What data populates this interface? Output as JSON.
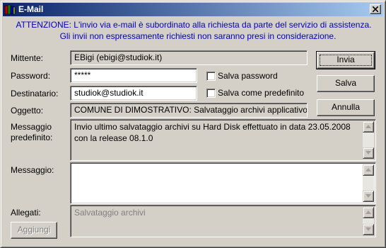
{
  "window": {
    "title": "E-Mail",
    "close_symbol": "×"
  },
  "notice": {
    "line1": "ATTENZIONE: L'invio via e-mail è subordinato alla richiesta da parte del servizio di assistenza.",
    "line2": "Gli invii non espressamente richiesti non saranno presi in considerazione.",
    "color": "#0000c0"
  },
  "form": {
    "mittente_label": "Mittente:",
    "mittente_value": "EBigi (ebigi@studiok.it)",
    "password_label": "Password:",
    "password_value": "*****",
    "salva_password_label": "Salva password",
    "salva_password_checked": false,
    "destinatario_label": "Destinatario:",
    "destinatario_value": "studiok@studiok.it",
    "salva_predefinito_label": "Salva come predefinito",
    "salva_predefinito_checked": false,
    "oggetto_label": "Oggetto:",
    "oggetto_value": "COMUNE DI DIMOSTRATIVO: Salvataggio archivi applicativo",
    "messaggio_predefinito_label_1": "Messaggio",
    "messaggio_predefinito_label_2": "predefinito:",
    "messaggio_predefinito_value_1": "Invio ultimo salvataggio archivi su Hard Disk effettuato in data 23.05.2008",
    "messaggio_predefinito_value_2": "con la release 08.1.0",
    "messaggio_label": "Messaggio:",
    "messaggio_value": "",
    "allegati_label": "Allegati:",
    "allegati_value": "Salvataggio archivi"
  },
  "buttons": {
    "invia": "Invia",
    "salva": "Salva",
    "annulla": "Annulla",
    "aggiungi": "Aggiungi"
  },
  "icons": {
    "app": "books-icon",
    "close": "close-icon",
    "scroll_up": "arrow-up-icon",
    "scroll_down": "arrow-down-icon"
  }
}
